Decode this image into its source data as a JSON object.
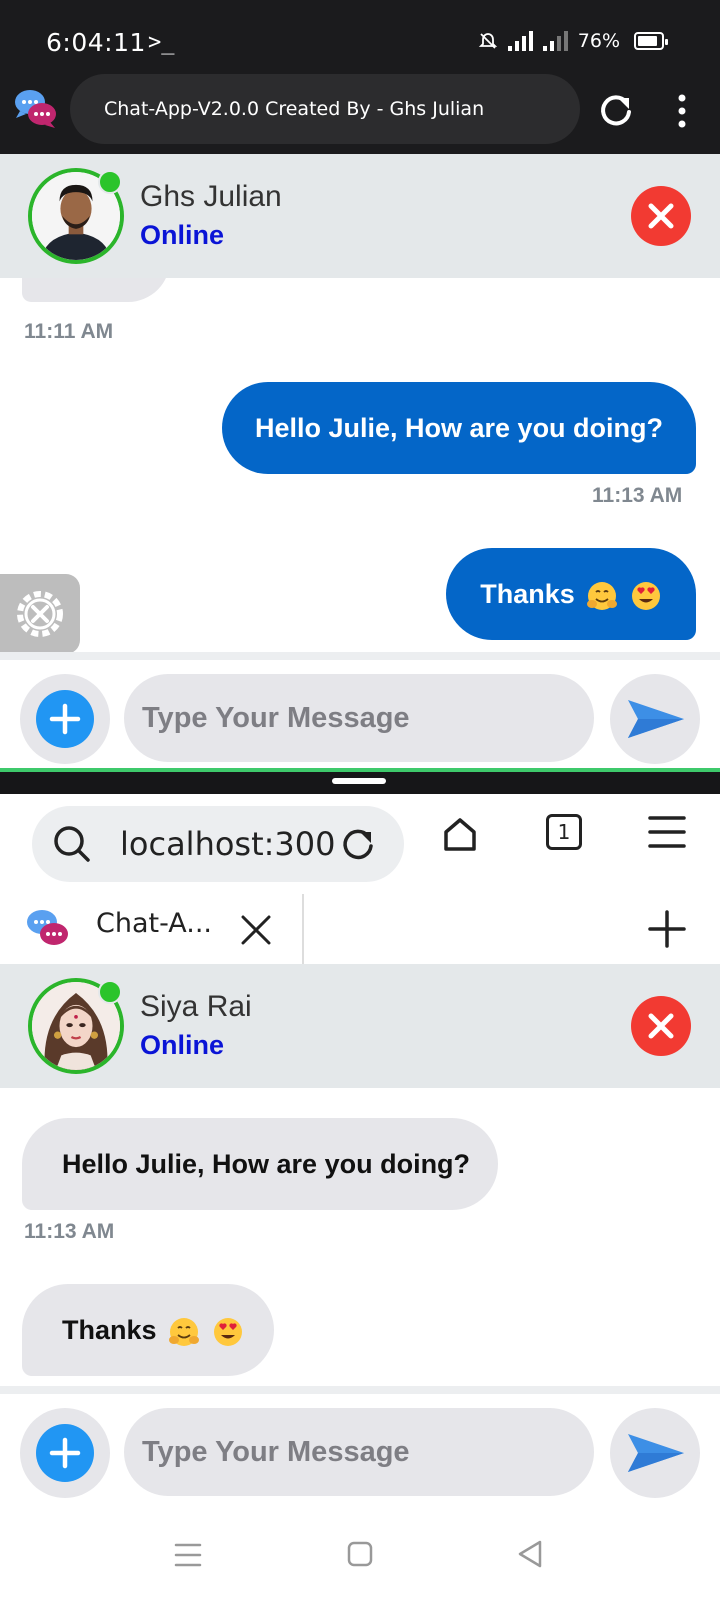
{
  "status_bar": {
    "time": "6:04:11",
    "terminal_glyph": ">_",
    "battery": "76%"
  },
  "browser_top": {
    "page_title": "Chat-App-V2.0.0 Created By - Ghs Julian",
    "icons": [
      "chat-app-icon",
      "reload-icon",
      "kebab-menu-icon"
    ]
  },
  "window_top": {
    "contact_name": "Ghs Julian",
    "contact_status": "Online",
    "messages": [
      {
        "side": "them",
        "text": "",
        "time": "11:11 AM"
      },
      {
        "side": "me",
        "text": "Hello Julie, How are you doing?",
        "time": "11:13 AM"
      },
      {
        "side": "me",
        "text": "Thanks",
        "emoji": [
          "hugging-face",
          "heart-eyes"
        ]
      }
    ],
    "input_placeholder": "Type Your Message"
  },
  "browser_bottom": {
    "url": "localhost:300",
    "tab_count": "1",
    "tab_title": "Chat-A...",
    "icons": [
      "search-icon",
      "reload-icon",
      "home-icon",
      "tabs-icon",
      "menu-icon",
      "close-tab-icon",
      "new-tab-icon"
    ]
  },
  "window_bottom": {
    "contact_name": "Siya Rai",
    "contact_status": "Online",
    "messages": [
      {
        "side": "them",
        "text": "Hello Julie, How are you doing?",
        "time": "11:13 AM"
      },
      {
        "side": "them",
        "text": "Thanks",
        "emoji": [
          "hugging-face",
          "heart-eyes"
        ]
      }
    ],
    "input_placeholder": "Type Your Message"
  },
  "colors": {
    "accent_blue": "#0466c8",
    "online_green": "#2bc42b",
    "close_red": "#f23a32",
    "status_text": "#0a14d6"
  }
}
